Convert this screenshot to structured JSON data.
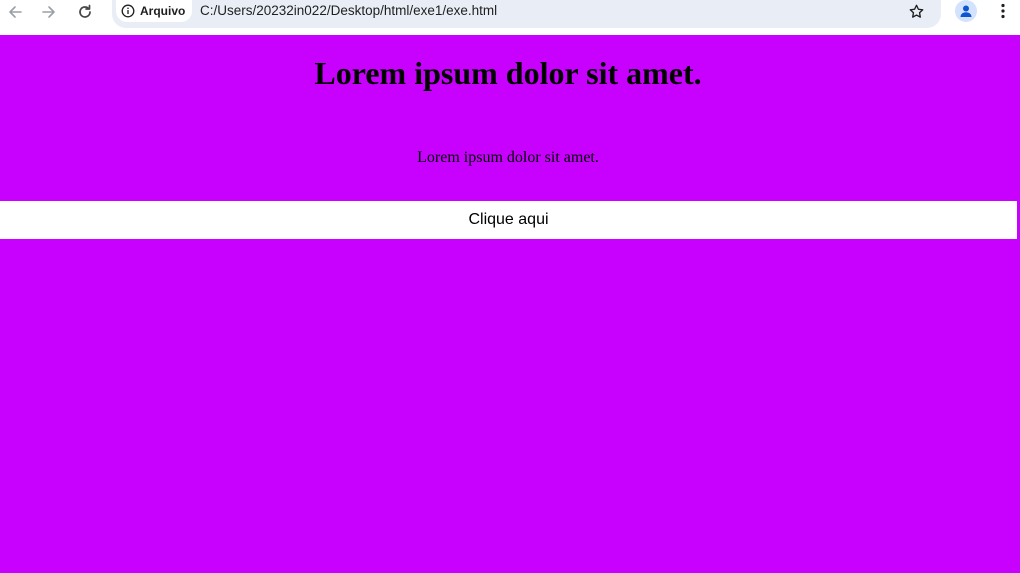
{
  "browser": {
    "site_info_label": "Arquivo",
    "url": "C:/Users/20232in022/Desktop/html/exe1/exe.html",
    "icons": {
      "back": "arrow-left-icon",
      "forward": "arrow-right-icon",
      "reload": "reload-icon",
      "site_info": "info-icon",
      "bookmark": "star-icon",
      "profile": "person-icon",
      "menu": "kebab-menu-icon"
    }
  },
  "page": {
    "background_color": "#c800fe",
    "title": "Lorem ipsum dolor sit amet.",
    "paragraph": "Lorem ipsum dolor sit amet.",
    "button_label": "Clique aqui"
  }
}
